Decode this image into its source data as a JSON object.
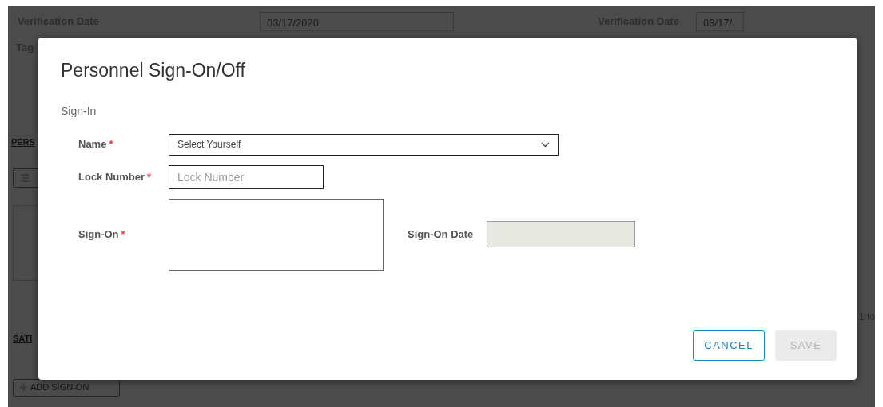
{
  "background": {
    "verification_fields": [
      {
        "label": "Verification Date",
        "value": "03/17/2020"
      },
      {
        "label": "Verification Date",
        "value": "03/17/"
      }
    ],
    "tag_label": "Tag",
    "section_1": "PERS",
    "pagination": "1 to",
    "section_2": "SATI",
    "add_button": "ADD SIGN-ON"
  },
  "dialog": {
    "title": "Personnel Sign-On/Off",
    "section": "Sign-In",
    "fields": [
      {
        "kind": "select",
        "label": "Name",
        "required_mark": "*",
        "value": "Select Yourself"
      },
      {
        "kind": "input",
        "label": "Lock Number",
        "required_mark": "*",
        "placeholder": "Lock Number"
      },
      {
        "kind": "textarea",
        "label": "Sign-On",
        "required_mark": "*",
        "side_field": {
          "label": "Sign-On Date",
          "disabled": true
        }
      }
    ],
    "buttons": [
      {
        "label": "CANCEL",
        "kind": "outline",
        "disabled": false
      },
      {
        "label": "SAVE",
        "kind": "solid",
        "disabled": true
      }
    ]
  }
}
